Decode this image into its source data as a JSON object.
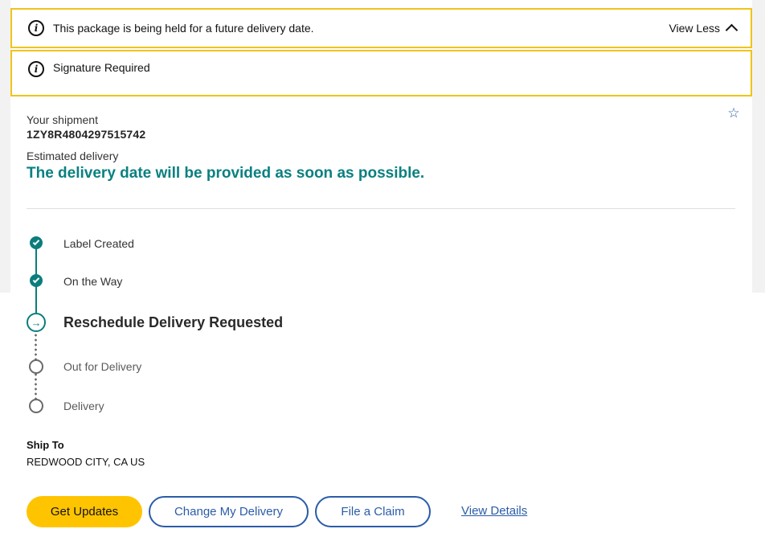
{
  "alerts": {
    "future_delivery": "This package is being held for a future delivery date.",
    "view_less": "View Less",
    "signature": "Signature Required"
  },
  "shipment": {
    "label": "Your shipment",
    "tracking_number": "1ZY8R4804297515742",
    "estimated_label": "Estimated delivery",
    "estimated_value": "The delivery date will be provided as soon as possible."
  },
  "progress": {
    "steps": [
      {
        "label": "Label Created",
        "status": "done"
      },
      {
        "label": "On the Way",
        "status": "done"
      },
      {
        "label": "Reschedule Delivery Requested",
        "status": "current"
      },
      {
        "label": "Out for Delivery",
        "status": "future"
      },
      {
        "label": "Delivery",
        "status": "future"
      }
    ]
  },
  "ship_to": {
    "title": "Ship To",
    "value": "REDWOOD CITY, CA US"
  },
  "actions": {
    "get_updates": "Get Updates",
    "change_delivery": "Change My Delivery",
    "file_claim": "File a Claim",
    "view_details": "View Details"
  },
  "icons": {
    "info": "info-icon",
    "star": "star-outline-icon",
    "chevron": "chevron-up-icon",
    "check": "check-icon",
    "arrow": "arrow-right-icon"
  },
  "colors": {
    "alert_border": "#f0c419",
    "teal": "#0a8080",
    "primary_button": "#ffc400",
    "link_blue": "#2a5ca8"
  }
}
